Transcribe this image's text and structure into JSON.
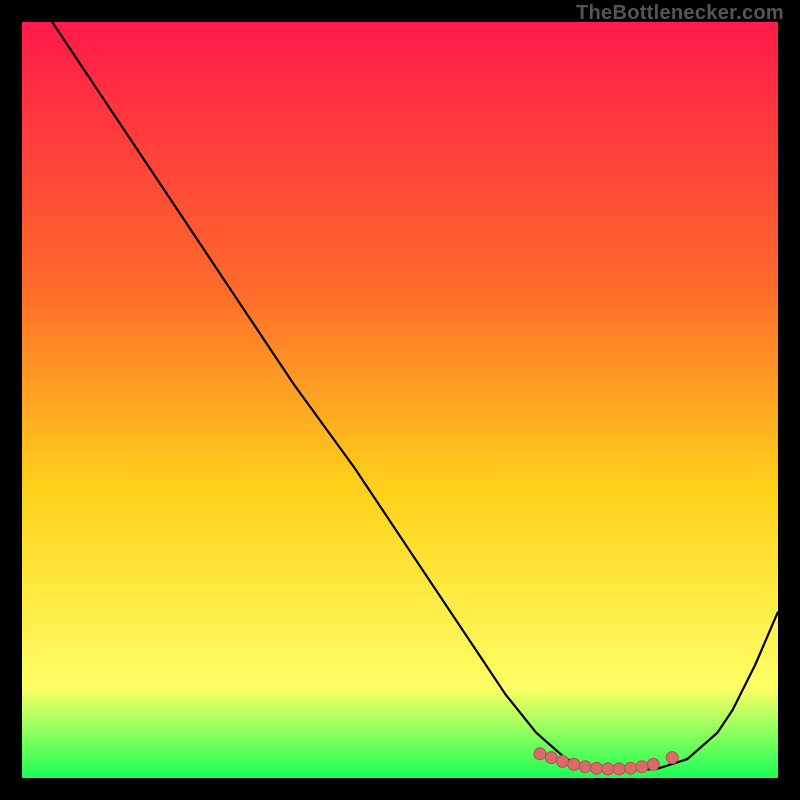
{
  "watermark": "TheBottlenecker.com",
  "colors": {
    "grad_top": "#ff1a4a",
    "grad_upper_mid": "#ff6a2a",
    "grad_mid": "#ffd21a",
    "grad_low": "#ffff66",
    "grad_bottom": "#1aff55",
    "curve": "#000000",
    "marker": "#d96b6b",
    "marker_stroke": "#b94f4f",
    "frame": "#000000"
  },
  "chart_data": {
    "type": "line",
    "title": "",
    "xlabel": "",
    "ylabel": "",
    "xlim": [
      0,
      100
    ],
    "ylim": [
      0,
      100
    ],
    "series": [
      {
        "name": "curve",
        "x": [
          4,
          12,
          20,
          28,
          36,
          44,
          52,
          60,
          64,
          68,
          72,
          76,
          80,
          84,
          88,
          92,
          94,
          97,
          100
        ],
        "y": [
          100,
          88,
          76,
          64,
          52,
          41,
          29,
          17,
          11,
          6,
          2.5,
          1.2,
          1.0,
          1.2,
          2.5,
          6,
          9,
          15,
          22
        ]
      }
    ],
    "markers": {
      "name": "highlight-band",
      "x": [
        68.5,
        70.0,
        71.5,
        73.0,
        74.5,
        76.0,
        77.5,
        79.0,
        80.5,
        82.0,
        83.5,
        86.0
      ],
      "y": [
        3.2,
        2.7,
        2.2,
        1.8,
        1.5,
        1.3,
        1.2,
        1.2,
        1.3,
        1.5,
        1.8,
        2.7
      ]
    }
  }
}
